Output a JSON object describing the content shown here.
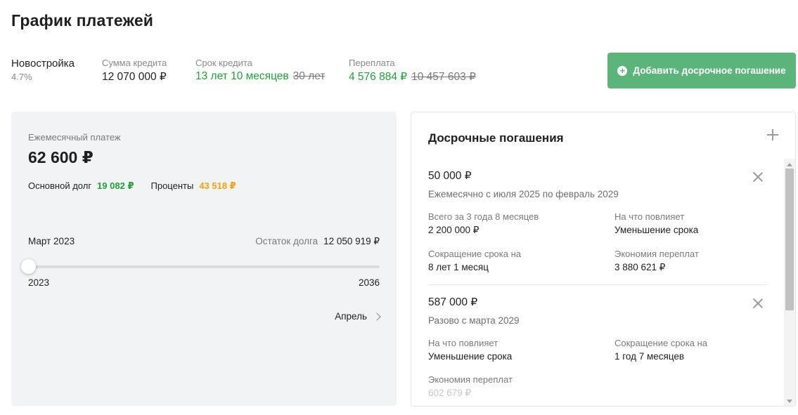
{
  "page": {
    "title": "График платежей"
  },
  "summary": {
    "program": {
      "name": "Новостройка",
      "rate": "4.7%"
    },
    "loan_amount": {
      "label": "Сумма кредита",
      "value": "12 070 000 ₽"
    },
    "loan_term": {
      "label": "Срок кредита",
      "value": "13 лет 10 месяцев",
      "old_value": "30 лет"
    },
    "overpayment": {
      "label": "Переплата",
      "value": "4 576 884 ₽",
      "old_value": "10 457 603 ₽"
    }
  },
  "actions": {
    "add_early_payment": "Добавить досрочное погашение"
  },
  "monthly": {
    "label": "Ежемесячный платеж",
    "amount": "62 600 ₽",
    "principal_label": "Основной долг",
    "principal_value": "19 082 ₽",
    "interest_label": "Проценты",
    "interest_value": "43 518 ₽",
    "current_month": "Март 2023",
    "balance_label": "Остаток долга",
    "balance_value": "12 050 919 ₽",
    "slider_position": 0,
    "year_start": "2023",
    "year_end": "2036",
    "next_label": "Апрель"
  },
  "early_payments": {
    "title": "Досрочные погашения",
    "items": [
      {
        "amount": "50 000 ₽",
        "description": "Ежемесячно с июля 2025 по февраль 2029",
        "fields": [
          {
            "label": "Всего за 3 года 8 месяцев",
            "value": "2 200 000 ₽"
          },
          {
            "label": "На что повлияет",
            "value": "Уменьшение срока"
          },
          {
            "label": "Сокращение срока на",
            "value": "8 лет 1 месяц"
          },
          {
            "label": "Экономия переплат",
            "value": "3 880 621 ₽"
          }
        ]
      },
      {
        "amount": "587 000 ₽",
        "description": "Разово с марта 2029",
        "fields": [
          {
            "label": "На что повлияет",
            "value": "Уменьшение срока"
          },
          {
            "label": "Сокращение срока на",
            "value": "1 год 7 месяцев"
          },
          {
            "label": "Экономия переплат",
            "value": "602 679 ₽"
          }
        ]
      }
    ]
  },
  "colors": {
    "accent_green": "#21a038",
    "button_green": "#5bb57a",
    "orange": "#f2a20c",
    "panel_bg": "#f2f3f5"
  }
}
